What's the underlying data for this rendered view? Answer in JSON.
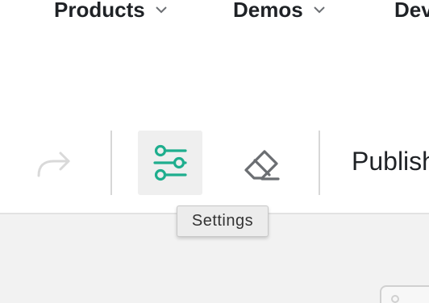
{
  "nav": {
    "items": [
      {
        "label": "Products",
        "icon": "chevron-down-icon"
      },
      {
        "label": "Demos",
        "icon": "chevron-down-icon"
      },
      {
        "label": "Dev"
      }
    ]
  },
  "toolbar": {
    "redo_icon": "redo-icon",
    "settings_icon": "sliders-icon",
    "eraser_icon": "eraser-icon",
    "publish_label": "Publish",
    "accent_color": "#1fae8e",
    "disabled_color": "#d9d9d9"
  },
  "tooltip": {
    "text": "Settings"
  }
}
